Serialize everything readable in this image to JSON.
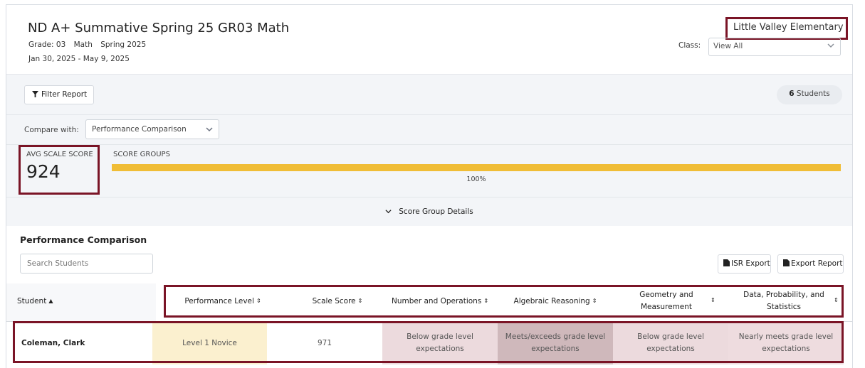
{
  "header": {
    "title": "ND A+ Summative Spring 25 GR03 Math",
    "grade": "Grade: 03",
    "subject": "Math",
    "term": "Spring 2025",
    "date_range": "Jan 30, 2025 - May 9, 2025",
    "school": "Little Valley Elementary",
    "class_label": "Class:",
    "class_value": "View All"
  },
  "toolbar": {
    "filter_label": "Filter Report",
    "students_count": "6",
    "students_label": " Students"
  },
  "compare": {
    "label": "Compare with:",
    "value": "Performance Comparison"
  },
  "summary": {
    "avg_label": "AVG SCALE SCORE",
    "avg_value": "924",
    "score_groups_label": "SCORE GROUPS",
    "score_groups_percent": "100%",
    "score_group_fill_fraction": 1.0,
    "score_group_color": "#f0bd36",
    "details_label": "Score Group Details"
  },
  "performance": {
    "title": "Performance Comparison",
    "search_placeholder": "Search Students",
    "isr_export_label": "ISR Export",
    "export_report_label": "Export Report"
  },
  "table": {
    "columns": [
      "Student",
      "Performance Level",
      "Scale Score",
      "Number and Operations",
      "Algebraic Reasoning",
      "Geometry and Measurement",
      "Data, Probability, and Statistics"
    ],
    "rows": [
      {
        "student": "Coleman, Clark",
        "performance_level": "Level 1 Novice",
        "scale_score": "971",
        "number_ops": "Below grade level expectations",
        "algebraic": "Meets/exceeds grade level expectations",
        "geometry": "Below grade level expectations",
        "data_prob": "Nearly meets grade level expectations"
      }
    ]
  },
  "colors": {
    "highlight_border": "#7a1426",
    "level_novice": "#fbf0cf",
    "below": "#ecdadd",
    "meets": "#cfb8bb",
    "nearly": "#eedcdf"
  }
}
